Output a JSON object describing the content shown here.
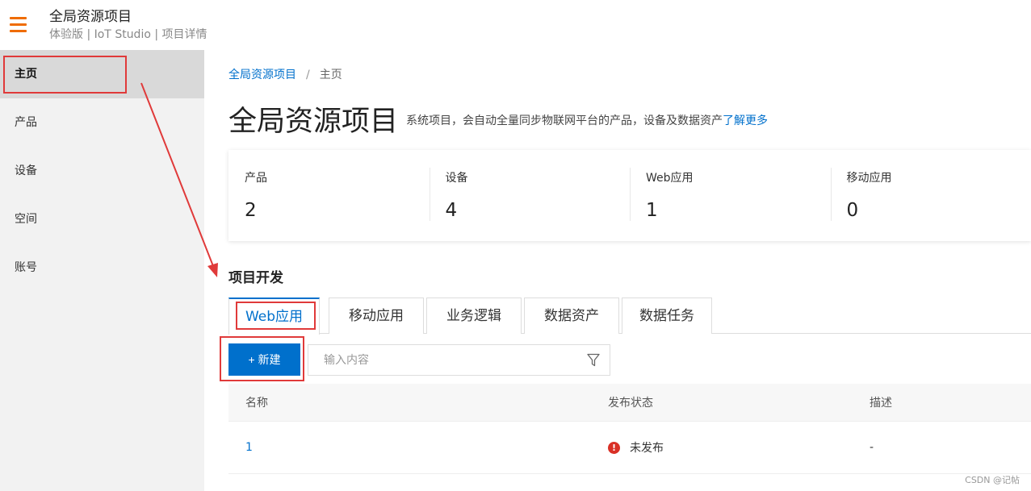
{
  "header": {
    "title": "全局资源项目",
    "subtitle": "体验版 | IoT Studio | 项目详情",
    "menu_icon": "hamburger-menu-icon",
    "accent_color": "#ef6c00"
  },
  "sidebar": {
    "items": [
      {
        "label": "主页",
        "active": true
      },
      {
        "label": "产品",
        "active": false
      },
      {
        "label": "设备",
        "active": false
      },
      {
        "label": "空间",
        "active": false
      },
      {
        "label": "账号",
        "active": false
      }
    ]
  },
  "breadcrumb": {
    "root": "全局资源项目",
    "separator": "/",
    "current": "主页"
  },
  "page": {
    "title": "全局资源项目",
    "description": "系统项目，会自动全量同步物联网平台的产品，设备及数据资产",
    "learn_more": "了解更多"
  },
  "stats": [
    {
      "label": "产品",
      "value": "2"
    },
    {
      "label": "设备",
      "value": "4"
    },
    {
      "label": "Web应用",
      "value": "1"
    },
    {
      "label": "移动应用",
      "value": "0"
    }
  ],
  "dev": {
    "section_title": "项目开发",
    "tabs": [
      "Web应用",
      "移动应用",
      "业务逻辑",
      "数据资产",
      "数据任务"
    ],
    "active_tab": "Web应用",
    "new_button": "+ 新建",
    "search_placeholder": "输入内容",
    "filter_icon": "filter-funnel-icon"
  },
  "table": {
    "columns": [
      "名称",
      "发布状态",
      "描述"
    ],
    "rows": [
      {
        "name": "1",
        "status": "未发布",
        "status_icon": "error-exclamation-icon",
        "description": "-"
      }
    ]
  },
  "colors": {
    "primary": "#0070cc",
    "error": "#d93026",
    "annotation": "#e03a3a"
  },
  "watermark": "CSDN @记帖"
}
